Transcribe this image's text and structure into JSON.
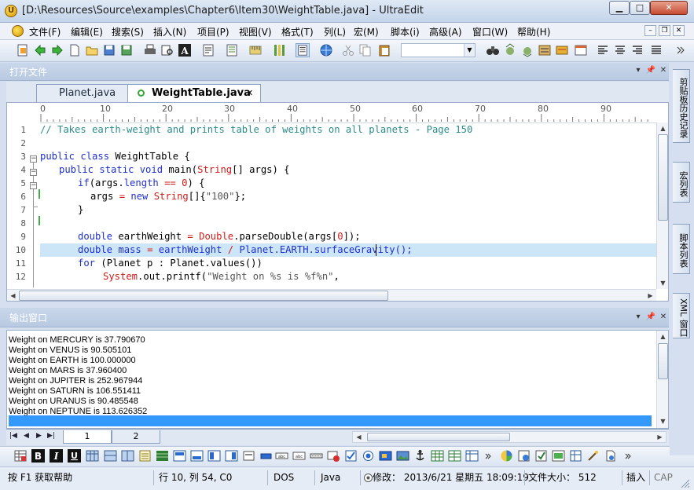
{
  "window": {
    "title": "[D:\\Resources\\Source\\examples\\Chapter6\\Item30\\WeightTable.java] - UltraEdit",
    "min_label": "▁",
    "max_label": "□",
    "close_label": "✕"
  },
  "menu": [
    "文件(F)",
    "编辑(E)",
    "搜索(S)",
    "插入(N)",
    "项目(P)",
    "视图(V)",
    "格式(T)",
    "列(L)",
    "宏(M)",
    "脚本(i)",
    "高级(A)",
    "窗口(W)",
    "帮助(H)"
  ],
  "open_files_panel": {
    "title": "打开文件"
  },
  "tabs": [
    {
      "label": "Planet.java"
    },
    {
      "label": "WeightTable.java",
      "active": true
    }
  ],
  "tab_close_glyph": "✕",
  "ruler": {
    "labels": [
      "0",
      "10",
      "20",
      "30",
      "40",
      "50",
      "60",
      "70",
      "80",
      "90"
    ]
  },
  "code_lines": [
    {
      "num": "1"
    },
    {
      "num": "2"
    },
    {
      "num": "3"
    },
    {
      "num": "4"
    },
    {
      "num": "5"
    },
    {
      "num": "6"
    },
    {
      "num": "7"
    },
    {
      "num": "8"
    },
    {
      "num": "9"
    },
    {
      "num": "10"
    },
    {
      "num": "11"
    },
    {
      "num": "12"
    }
  ],
  "code": {
    "l1": "// Takes earth-weight and prints table of weights on all planets - Page 150",
    "l3_kw": "public class",
    "l3_rest": " WeightTable {",
    "l4_kw": "public static void",
    "l4_a": " main(",
    "l4_type": "String",
    "l4_b": "[] args) {",
    "l5_kw": "if",
    "l5_a": "(args.",
    "l5_len": "length",
    "l5_eq": " == ",
    "l5_zero": "0",
    "l5_b": ") {",
    "l6_a": "args ",
    "l6_eq": "=",
    "l6_new": " new ",
    "l6_type": "String",
    "l6_b": "[]{",
    "l6_str": "\"100\"",
    "l6_c": "};",
    "l7": "}",
    "l9_kw": "double",
    "l9_a": " earthWeight ",
    "l9_eq": "=",
    "l9_dbl": " Double",
    "l9_b": ".parseDouble(args[",
    "l9_zero": "0",
    "l9_c": "]);",
    "l10_kw": "double",
    "l10_a": " mass ",
    "l10_eq": "=",
    "l10_b": " earthWeight ",
    "l10_div": "/",
    "l10_c": " Planet.EARTH.surfaceGravity();",
    "l11_kw": "for",
    "l11_a": " (Planet p : Planet.values())",
    "l12_sys": "System",
    "l12_a": ".out.printf(",
    "l12_str": "\"Weight on %s is %f%n\"",
    "l12_b": ","
  },
  "output_panel": {
    "title": "输出窗口",
    "lines": [
      "Weight on MERCURY is 37.790670",
      "Weight on VENUS is 90.505101",
      "Weight on EARTH is 100.000000",
      "Weight on MARS is 37.960400",
      "Weight on JUPITER is 252.967944",
      "Weight on SATURN is 106.551411",
      "Weight on URANUS is 90.485548",
      "Weight on NEPTUNE is 113.626352"
    ],
    "tabs": [
      "1",
      "2"
    ]
  },
  "side_tabs": [
    "剪贴板历史记录",
    "宏列表",
    "脚本列表",
    "XML 窗口"
  ],
  "status": {
    "help": "按 F1 获取帮助",
    "position": "行 10, 列 54, C0",
    "line_ending": "DOS",
    "language": "Java",
    "modified": "修改： 2013/6/21 星期五 18:09:19",
    "file_size": "文件大小： 512",
    "insert_mode": "插入",
    "caps": "CAP"
  },
  "colors": {
    "comment": "#2c8a8a",
    "keyword": "#1e2fd0",
    "highlight_line": "#cde6f7",
    "output_selection": "#3399ff"
  }
}
